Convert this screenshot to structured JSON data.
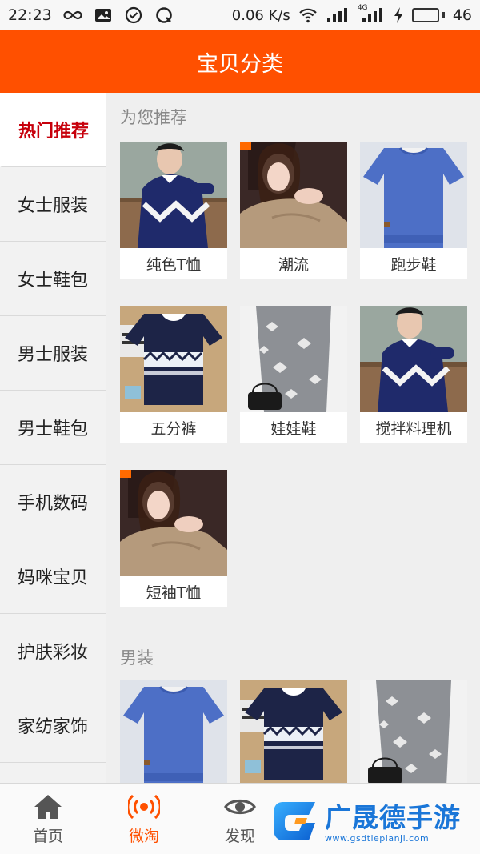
{
  "status_bar": {
    "time": "22:23",
    "speed": "0.06 K/s",
    "network": "4G",
    "battery": "46",
    "battery_level": 0.46
  },
  "header": {
    "title": "宝贝分类"
  },
  "sidebar": {
    "items": [
      {
        "label": "热门推荐",
        "active": true
      },
      {
        "label": "女士服装"
      },
      {
        "label": "女士鞋包"
      },
      {
        "label": "男士服装"
      },
      {
        "label": "男士鞋包"
      },
      {
        "label": "手机数码"
      },
      {
        "label": "妈咪宝贝"
      },
      {
        "label": "护肤彩妆"
      },
      {
        "label": "家纺家饰"
      }
    ]
  },
  "sections": [
    {
      "title": "为您推荐",
      "items": [
        {
          "label": "纯色T恤",
          "image": "man-navy-sweater"
        },
        {
          "label": "潮流",
          "image": "woman-knit-sweater"
        },
        {
          "label": "跑步鞋",
          "image": "blue-sweater"
        },
        {
          "label": "五分裤",
          "image": "navy-pattern-sweater"
        },
        {
          "label": "娃娃鞋",
          "image": "grey-floral-dress"
        },
        {
          "label": "搅拌料理机",
          "image": "man-navy-sweater"
        },
        {
          "label": "短袖T恤",
          "image": "woman-knit-sweater"
        }
      ]
    },
    {
      "title": "男装",
      "items": [
        {
          "label": "",
          "image": "blue-sweater"
        },
        {
          "label": "",
          "image": "navy-pattern-sweater"
        },
        {
          "label": "",
          "image": "grey-floral-dress"
        }
      ]
    }
  ],
  "tabbar": {
    "tabs": [
      {
        "label": "首页",
        "icon": "home-icon"
      },
      {
        "label": "微淘",
        "icon": "broadcast-icon",
        "active": true
      },
      {
        "label": "发现",
        "icon": "eye-icon"
      }
    ]
  },
  "watermark": {
    "title": "广晟德手游",
    "url": "www.gsdtiepianji.com"
  },
  "colors": {
    "accent": "#ff5000",
    "active_category": "#c7000b",
    "watermark": "#1a76d8"
  }
}
